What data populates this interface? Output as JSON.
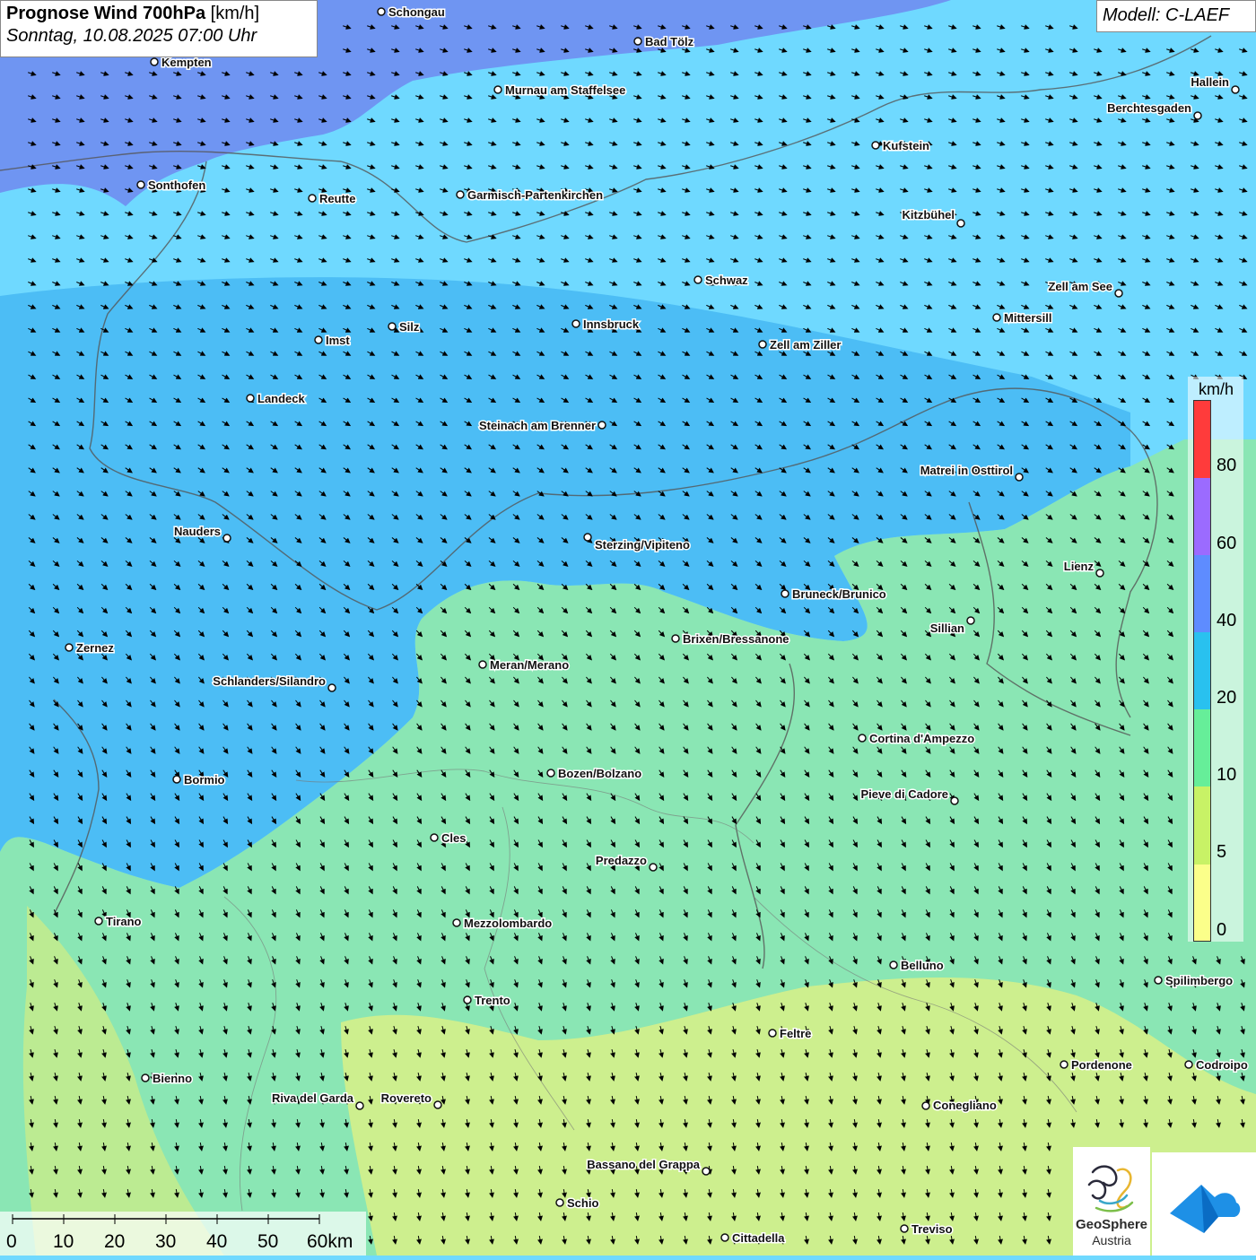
{
  "header": {
    "title_bold": "Prognose Wind 700hPa",
    "title_unit": "[km/h]",
    "datetime": "Sonntag, 10.08.2025 07:00 Uhr",
    "model": "Modell: C-LAEF"
  },
  "legend": {
    "unit": "km/h",
    "ticks": [
      "80",
      "60",
      "40",
      "20",
      "10",
      "5",
      "0"
    ],
    "colors": [
      "#ff3b3b",
      "#9b6bff",
      "#5e8cff",
      "#29c1ef",
      "#66ee99",
      "#c8f266",
      "#fbff8a"
    ]
  },
  "scalebar": {
    "labels": [
      "0",
      "10",
      "20",
      "30",
      "40",
      "50",
      "60km"
    ]
  },
  "logos": {
    "geosphere_line1": "GeoSphere",
    "geosphere_line2": "Austria",
    "geosphere_icon": "geosphere-swirl-icon",
    "app_icon": "weather-app-icon"
  },
  "cities": [
    {
      "name": "Schongau"
    },
    {
      "name": "Bad Tölz"
    },
    {
      "name": "Kempten"
    },
    {
      "name": "Murnau am Staffelsee"
    },
    {
      "name": "Hallein"
    },
    {
      "name": "Berchtesgaden"
    },
    {
      "name": "Kufstein"
    },
    {
      "name": "Sonthofen"
    },
    {
      "name": "Reutte"
    },
    {
      "name": "Garmisch-Partenkirchen"
    },
    {
      "name": "Kitzbühel"
    },
    {
      "name": "Schwaz"
    },
    {
      "name": "Zell am See"
    },
    {
      "name": "Mittersill"
    },
    {
      "name": "Innsbruck"
    },
    {
      "name": "Silz"
    },
    {
      "name": "Imst"
    },
    {
      "name": "Zell am Ziller"
    },
    {
      "name": "Landeck"
    },
    {
      "name": "Steinach am Brenner"
    },
    {
      "name": "Matrei in Osttirol"
    },
    {
      "name": "Nauders"
    },
    {
      "name": "Sterzing/Vipiteno"
    },
    {
      "name": "Lienz"
    },
    {
      "name": "Bruneck/Brunico"
    },
    {
      "name": "Sillian"
    },
    {
      "name": "Zernez"
    },
    {
      "name": "Brixen/Bressanone"
    },
    {
      "name": "Meran/Merano"
    },
    {
      "name": "Schlanders/Silandro"
    },
    {
      "name": "Cortina d'Ampezzo"
    },
    {
      "name": "Bozen/Bolzano"
    },
    {
      "name": "Bormio"
    },
    {
      "name": "Pieve di Cadore"
    },
    {
      "name": "Cles"
    },
    {
      "name": "Predazzo"
    },
    {
      "name": "Tirano"
    },
    {
      "name": "Mezzolombardo"
    },
    {
      "name": "Belluno"
    },
    {
      "name": "Spilimbergo"
    },
    {
      "name": "Trento"
    },
    {
      "name": "Feltre"
    },
    {
      "name": "Pordenone"
    },
    {
      "name": "Codroipo"
    },
    {
      "name": "Bienno"
    },
    {
      "name": "Riva del Garda"
    },
    {
      "name": "Rovereto"
    },
    {
      "name": "Conegliano"
    },
    {
      "name": "Bassano del Grappa"
    },
    {
      "name": "Schio"
    },
    {
      "name": "Treviso"
    },
    {
      "name": "Cittadella"
    }
  ]
}
